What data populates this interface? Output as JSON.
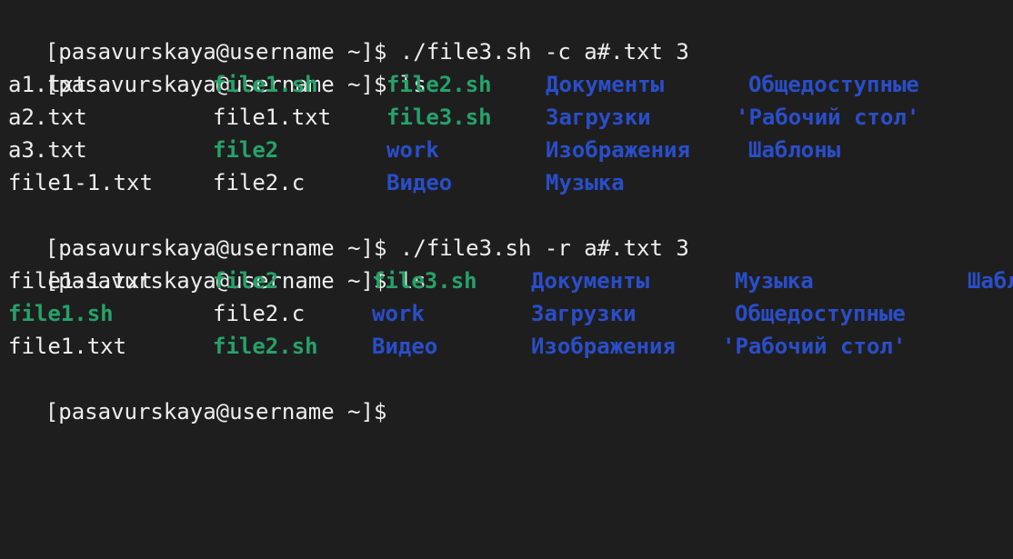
{
  "terminal": {
    "prompt": "[pasavurskaya@username ~]$",
    "commands": {
      "c1": " ./file3.sh -c a#.txt 3",
      "c2": " ls",
      "c3": " ./file3.sh -r a#.txt 3",
      "c4": " ls",
      "c5": ""
    },
    "ls1": {
      "r0": [
        "a1.txt",
        "file1.sh",
        "file2.sh",
        "Документы",
        "Общедоступные"
      ],
      "r1": [
        "a2.txt",
        "file1.txt",
        "file3.sh",
        "Загрузки",
        "'Рабочий стол'"
      ],
      "r2": [
        "a3.txt",
        "file2",
        "work",
        "Изображения",
        "Шаблоны"
      ],
      "r3": [
        "file1-1.txt",
        "file2.c",
        "Видео",
        "Музыка"
      ]
    },
    "ls2": {
      "r0": [
        "file1-1.txt",
        "file2",
        "file3.sh",
        "Документы",
        "Музыка",
        "Шабл"
      ],
      "r1": [
        "file1.sh",
        "file2.c",
        "work",
        "Загрузки",
        "Общедоступные"
      ],
      "r2": [
        "file1.txt",
        "file2.sh",
        "Видео",
        "Изображения",
        "'Рабочий стол'"
      ]
    }
  },
  "colors": {
    "background": "#1e1e1e",
    "text": "#eeeeee",
    "executable": "#26a269",
    "directory": "#2a4ec9"
  }
}
